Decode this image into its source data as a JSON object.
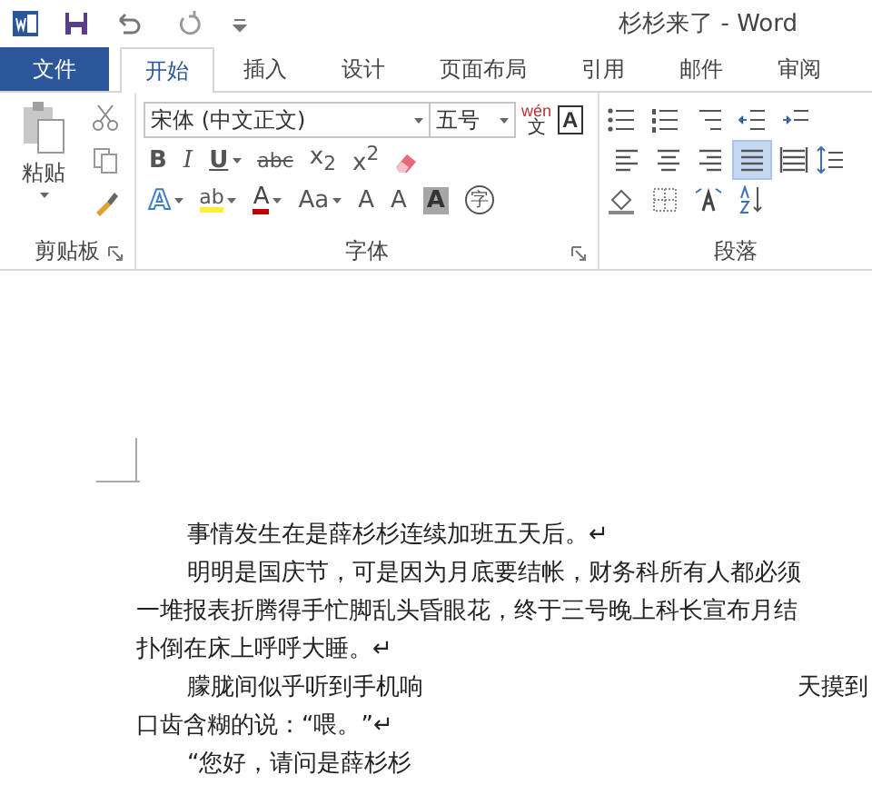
{
  "title_bar": {
    "title": "杉杉来了 - Word"
  },
  "tabs": [
    {
      "label": "文件",
      "kind": "file",
      "selected": false
    },
    {
      "label": "开始",
      "kind": "tab",
      "selected": true
    },
    {
      "label": "插入",
      "kind": "tab",
      "selected": false
    },
    {
      "label": "设计",
      "kind": "tab",
      "selected": false
    },
    {
      "label": "页面布局",
      "kind": "tab",
      "selected": false
    },
    {
      "label": "引用",
      "kind": "tab",
      "selected": false
    },
    {
      "label": "邮件",
      "kind": "tab",
      "selected": false
    },
    {
      "label": "审阅",
      "kind": "tab",
      "selected": false
    }
  ],
  "clipboard": {
    "label": "剪贴板",
    "paste_label": "粘贴"
  },
  "font": {
    "label": "字体",
    "font_name": "宋体 (中文正文)",
    "font_size": "五号",
    "phonetic_top": "wén",
    "phonetic_bottom": "文",
    "border_char": "A",
    "row2": [
      {
        "text": "B",
        "kind": "bold",
        "dropdown": false
      },
      {
        "text": "I",
        "kind": "italic",
        "dropdown": false
      },
      {
        "text": "U",
        "kind": "underline",
        "dropdown": true
      },
      {
        "text": "abc",
        "kind": "strike",
        "dropdown": false
      },
      {
        "text": "x$_{2}$",
        "kind": "script",
        "dropdown": false
      },
      {
        "text": "x$^{2}$",
        "kind": "script",
        "dropdown": false
      }
    ],
    "row3": [
      {
        "text": "A",
        "kind": "effect",
        "dropdown": true
      },
      {
        "text": "ab",
        "kind": "highlight",
        "dropdown": true
      },
      {
        "text": "A",
        "kind": "color",
        "dropdown": true
      },
      {
        "text": "Aa",
        "kind": "plain",
        "dropdown": true
      },
      {
        "text": "A",
        "kind": "grow",
        "dropdown": false
      },
      {
        "text": "A",
        "kind": "shrink",
        "dropdown": false
      },
      {
        "text": "A",
        "kind": "shade",
        "dropdown": false
      },
      {
        "text": "字",
        "kind": "enclose",
        "dropdown": false
      }
    ]
  },
  "paragraph": {
    "label": "段落",
    "align": [
      {
        "kind": "left",
        "selected": false
      },
      {
        "kind": "center",
        "selected": false
      },
      {
        "kind": "right",
        "selected": false
      },
      {
        "kind": "justify",
        "selected": true
      },
      {
        "kind": "distribute",
        "selected": false
      }
    ]
  },
  "document": {
    "lines": [
      {
        "indent": true,
        "segments": [
          "事情发生在是薛杉杉连续加班五天后。↵"
        ]
      },
      {
        "indent": true,
        "segments": [
          "明明是国庆节，可是因为月底要结帐，财务科所有人都必须"
        ]
      },
      {
        "indent": false,
        "segments": [
          "一堆报表折腾得手忙脚乱头昏眼花，终于三号晚上科长宣布月结"
        ]
      },
      {
        "indent": false,
        "segments": [
          "扑倒在床上呼呼大睡。↵"
        ]
      },
      {
        "indent": true,
        "segments": [
          "朦胧间似乎听到手机响",
          "天摸到"
        ]
      },
      {
        "indent": false,
        "segments": [
          "口齿含糊的说：“喂。”↵"
        ]
      },
      {
        "indent": true,
        "segments": [
          "“您好，请问是薛杉杉"
        ]
      }
    ]
  }
}
